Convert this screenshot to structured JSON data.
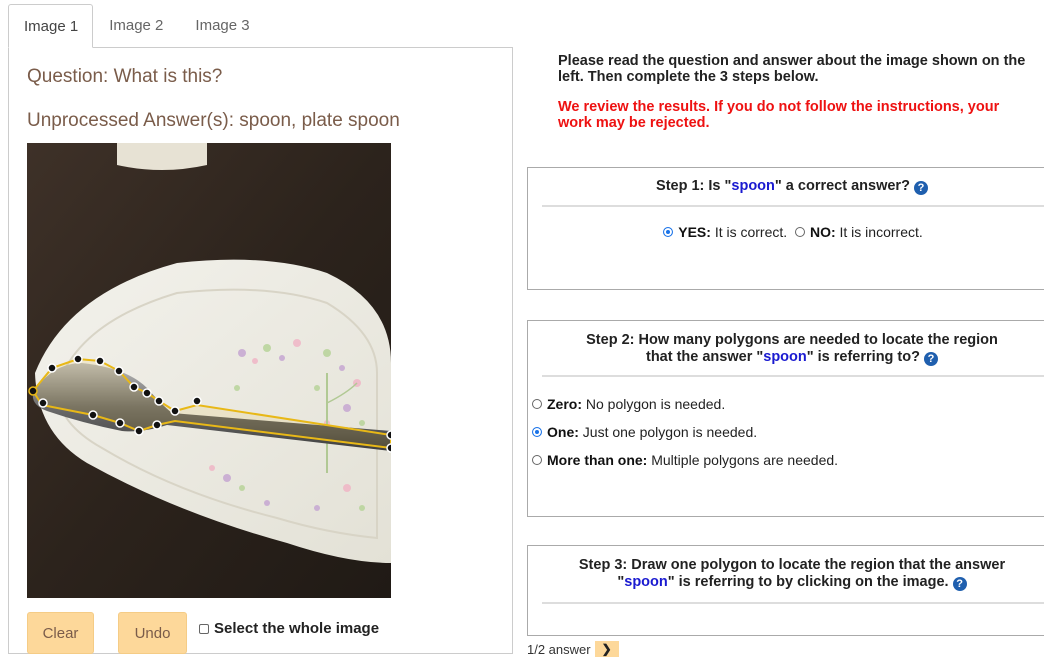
{
  "tabs": [
    "Image 1",
    "Image 2",
    "Image 3"
  ],
  "left": {
    "question": "Question: What is this?",
    "answers": "Unprocessed Answer(s): spoon, plate spoon",
    "clear_label": "Clear",
    "undo_label": "Undo",
    "select_whole_label": "Select the whole image"
  },
  "instructions": {
    "line1": "Please read the question and answer about the image shown on the left. Then complete the 3 steps below.",
    "warning": "We review the results. If you do not follow the instructions, your work may be rejected."
  },
  "step1": {
    "title_pre": "Step 1: Is \"",
    "answer": "spoon",
    "title_post": "\" a correct answer?",
    "yes_label": "YES:",
    "yes_text": "It is correct.",
    "no_label": "NO:",
    "no_text": "It is incorrect.",
    "selected": "yes"
  },
  "step2": {
    "title_line1": "Step 2: How many polygons are needed to locate the region",
    "title_line2_pre": "that the answer \"",
    "answer": "spoon",
    "title_line2_post": "\" is referring to?",
    "options": [
      {
        "label": "Zero:",
        "text": "No polygon is needed."
      },
      {
        "label": "One:",
        "text": "Just one polygon is needed."
      },
      {
        "label": "More than one:",
        "text": "Multiple polygons are needed."
      }
    ],
    "selected": "One"
  },
  "step3": {
    "title_line1": "Step 3: Draw one polygon to locate the region that the answer",
    "title_line2_pre": "\"",
    "answer": "spoon",
    "title_line2_post": "\" is referring to by clicking on the image."
  },
  "pager": {
    "text": "1/2 answer",
    "next_icon": "chevron-right-icon"
  },
  "help_icon": "question-circle-icon",
  "colors": {
    "accent_button": "#fdd89a",
    "highlight": "#1a1ad0",
    "warning": "#ee1111",
    "help_icon": "#1f5fae",
    "polygon": "#e8b817"
  }
}
